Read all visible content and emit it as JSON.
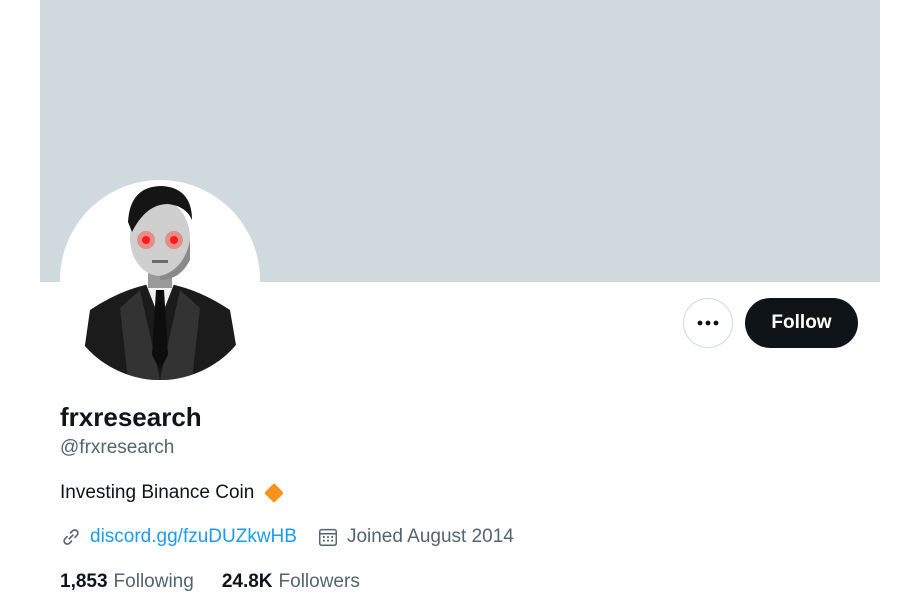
{
  "profile": {
    "display_name": "frxresearch",
    "handle": "@frxresearch",
    "bio": "Investing Binance Coin",
    "link_text": "discord.gg/fzuDUZkwHB",
    "joined": "Joined August 2014"
  },
  "stats": {
    "following_count": "1,853",
    "following_label": "Following",
    "followers_count": "24.8K",
    "followers_label": "Followers"
  },
  "actions": {
    "follow_label": "Follow",
    "more_icon": "more-horizontal-icon"
  },
  "colors": {
    "banner": "#cfd9de",
    "follow_button": "#0f1419",
    "link": "#1d9bf0",
    "muted_text": "#536471",
    "bio_emoji": "#f7931a"
  },
  "icons": [
    "link-icon",
    "calendar-icon",
    "orange-diamond-icon",
    "more-horizontal-icon"
  ]
}
